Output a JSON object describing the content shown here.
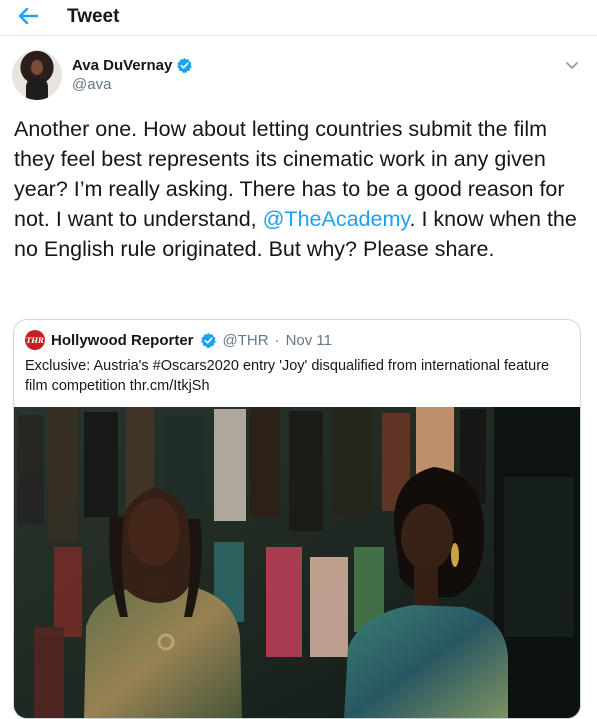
{
  "header": {
    "back_icon": "arrow-left-icon",
    "title": "Tweet"
  },
  "tweet": {
    "author": {
      "name": "Ava DuVernay",
      "handle": "@ava",
      "verified": true
    },
    "text_before": "Another one. How about letting countries submit the film they feel best represents its cinematic work in any given year? I’m really asking. There has to be a good reason for not. I want to understand, ",
    "mention": "@TheAcademy",
    "text_after": ". I know when the no English rule originated. But why? Please share."
  },
  "quote": {
    "logo_text": "THR",
    "name": "Hollywood Reporter",
    "verified": true,
    "handle": "@THR",
    "separator": "·",
    "date": "Nov 11",
    "text": "Exclusive: Austria's #Oscars2020 entry 'Joy' disqualified from international feature film competition thr.cm/ItkjSh"
  },
  "colors": {
    "accent": "#1da1f2",
    "secondary_text": "#657786",
    "border": "#ccd6dd"
  }
}
